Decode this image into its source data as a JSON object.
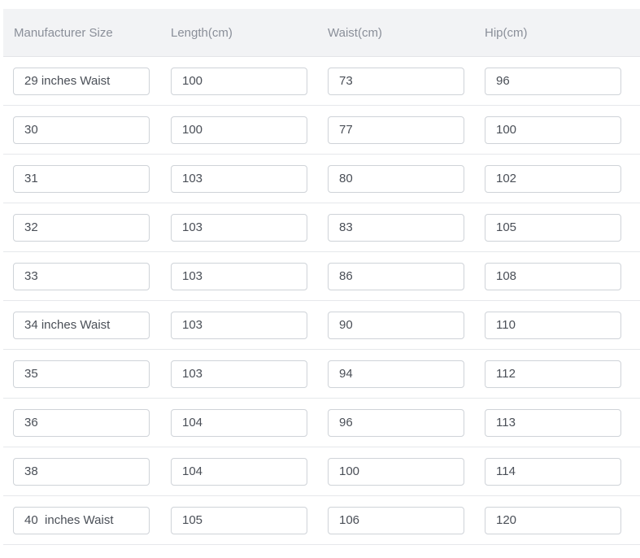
{
  "table": {
    "headers": [
      "Manufacturer Size",
      "Length(cm)",
      "Waist(cm)",
      "Hip(cm)"
    ],
    "rows": [
      [
        "29 inches Waist",
        "100",
        "73",
        "96"
      ],
      [
        "30",
        "100",
        "77",
        "100"
      ],
      [
        "31",
        "103",
        "80",
        "102"
      ],
      [
        "32",
        "103",
        "83",
        "105"
      ],
      [
        "33",
        "103",
        "86",
        "108"
      ],
      [
        "34 inches Waist",
        "103",
        "90",
        "110"
      ],
      [
        "35",
        "103",
        "94",
        "112"
      ],
      [
        "36",
        "104",
        "96",
        "113"
      ],
      [
        "38",
        "104",
        "100",
        "114"
      ],
      [
        "40  inches Waist",
        "105",
        "106",
        "120"
      ]
    ]
  }
}
